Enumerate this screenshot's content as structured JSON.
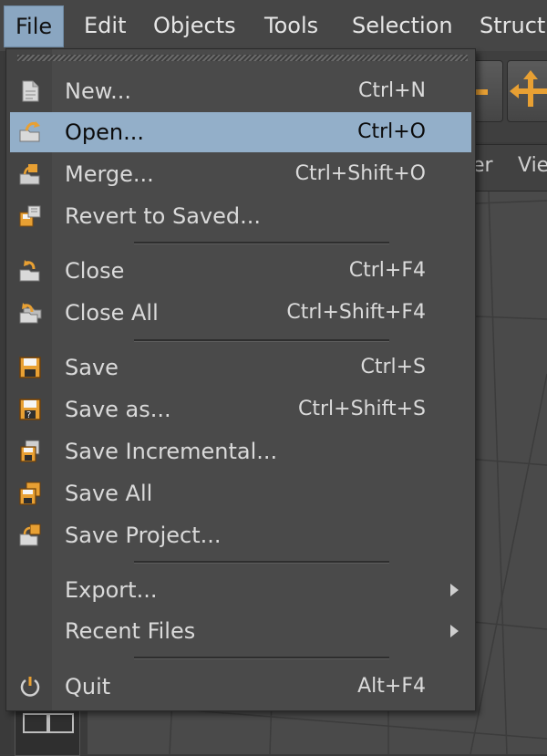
{
  "menubar": {
    "items": [
      {
        "label": "File",
        "active": true
      },
      {
        "label": "Edit"
      },
      {
        "label": "Objects"
      },
      {
        "label": "Tools"
      },
      {
        "label": "Selection"
      },
      {
        "label": "Structu"
      }
    ]
  },
  "background": {
    "tabs": [
      "er",
      "Vie"
    ]
  },
  "file_menu": {
    "items": [
      {
        "label": "New...",
        "shortcut": "Ctrl+N",
        "icon": "new-file-icon"
      },
      {
        "label": "Open...",
        "shortcut": "Ctrl+O",
        "icon": "open-folder-icon",
        "highlighted": true
      },
      {
        "label": "Merge...",
        "shortcut": "Ctrl+Shift+O",
        "icon": "merge-icon"
      },
      {
        "label": "Revert to Saved...",
        "shortcut": "",
        "icon": "revert-icon"
      },
      {
        "label": "Close",
        "shortcut": "Ctrl+F4",
        "icon": "close-file-icon"
      },
      {
        "label": "Close All",
        "shortcut": "Ctrl+Shift+F4",
        "icon": "close-all-icon"
      },
      {
        "label": "Save",
        "shortcut": "Ctrl+S",
        "icon": "save-icon"
      },
      {
        "label": "Save as...",
        "shortcut": "Ctrl+Shift+S",
        "icon": "save-as-icon"
      },
      {
        "label": "Save Incremental...",
        "shortcut": "",
        "icon": "save-incremental-icon"
      },
      {
        "label": "Save All",
        "shortcut": "",
        "icon": "save-all-icon"
      },
      {
        "label": "Save Project...",
        "shortcut": "",
        "icon": "save-project-icon"
      },
      {
        "label": "Export...",
        "shortcut": "",
        "icon": "",
        "submenu": true
      },
      {
        "label": "Recent Files",
        "shortcut": "",
        "icon": "",
        "submenu": true
      },
      {
        "label": "Quit",
        "shortcut": "Alt+F4",
        "icon": "quit-icon"
      }
    ]
  },
  "colors": {
    "highlight": "#93afc9",
    "menu_bg": "#4a4a4a",
    "accent_orange": "#e8a033"
  }
}
